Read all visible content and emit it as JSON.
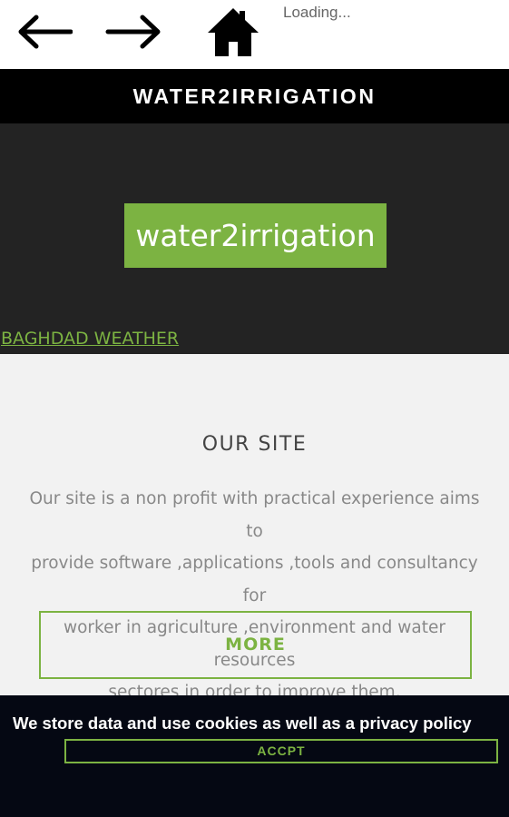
{
  "toolbar": {
    "back_icon": "arrow-left-icon",
    "forward_icon": "arrow-right-icon",
    "home_icon": "home-icon",
    "status": "Loading..."
  },
  "header": {
    "title": "WATER2IRRIGATION"
  },
  "hero": {
    "brand_button": "water2irrigation",
    "weather_link": "BAGHDAD WEATHER"
  },
  "about": {
    "heading": "OUR SITE",
    "lines": [
      "Our site is a non profit with practical experience aims to",
      "provide software ,applications ,tools and consultancy for",
      "worker in agriculture ,environment and water resources",
      "sectores in order to improve them."
    ],
    "more_button": "MORE"
  },
  "cookie_banner": {
    "message": "We store data and use cookies as well as a privacy policy",
    "accept_button": "ACCPT"
  },
  "colors": {
    "accent": "#7cb342",
    "hero_bg": "#232323",
    "titlebar_bg": "#000000",
    "cookie_bg": "#050813"
  }
}
